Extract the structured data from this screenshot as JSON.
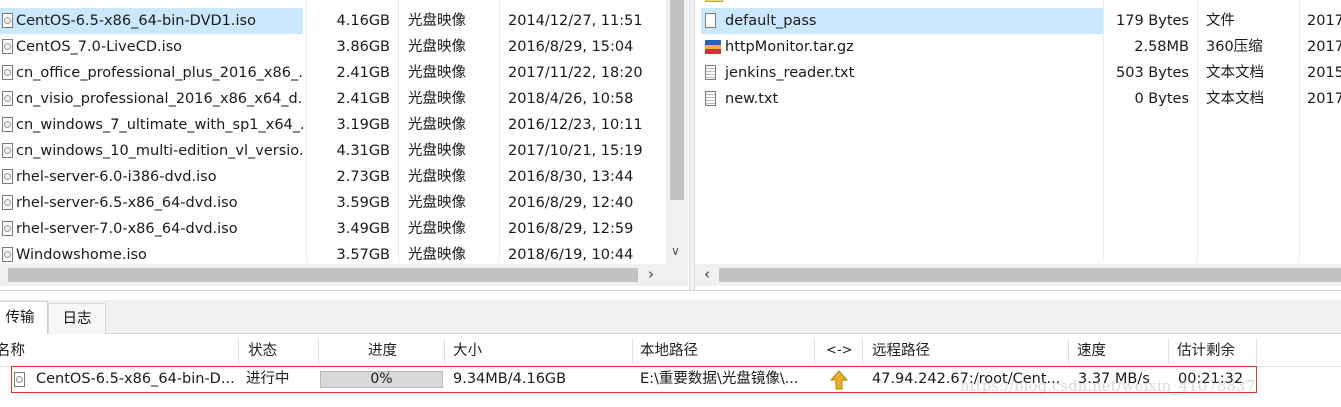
{
  "left_files": [
    {
      "name": "CentOS-6.5-x86_64-bin-DVD1.iso",
      "size": "4.16GB",
      "type": "光盘映像",
      "date": "2014/12/27, 11:51",
      "icon": "disc-file-icon",
      "selected": true
    },
    {
      "name": "CentOS_7.0-LiveCD.iso",
      "size": "3.86GB",
      "type": "光盘映像",
      "date": "2016/8/29, 15:04",
      "icon": "disc-file-icon"
    },
    {
      "name": "cn_office_professional_plus_2016_x86_...",
      "size": "2.41GB",
      "type": "光盘映像",
      "date": "2017/11/22, 18:20",
      "icon": "disc-file-icon"
    },
    {
      "name": "cn_visio_professional_2016_x86_x64_d...",
      "size": "2.41GB",
      "type": "光盘映像",
      "date": "2018/4/26, 10:58",
      "icon": "disc-file-icon"
    },
    {
      "name": "cn_windows_7_ultimate_with_sp1_x64_...",
      "size": "3.19GB",
      "type": "光盘映像",
      "date": "2016/12/23, 10:11",
      "icon": "disc-file-icon"
    },
    {
      "name": "cn_windows_10_multi-edition_vl_versio...",
      "size": "4.31GB",
      "type": "光盘映像",
      "date": "2017/10/21, 15:19",
      "icon": "disc-file-icon"
    },
    {
      "name": "rhel-server-6.0-i386-dvd.iso",
      "size": "2.73GB",
      "type": "光盘映像",
      "date": "2016/8/30, 13:44",
      "icon": "disc-file-icon"
    },
    {
      "name": "rhel-server-6.5-x86_64-dvd.iso",
      "size": "3.59GB",
      "type": "光盘映像",
      "date": "2016/8/29, 12:40",
      "icon": "disc-file-icon"
    },
    {
      "name": "rhel-server-7.0-x86_64-dvd.iso",
      "size": "3.49GB",
      "type": "光盘映像",
      "date": "2016/8/29, 12:59",
      "icon": "disc-file-icon"
    },
    {
      "name": "Windowshome.iso",
      "size": "3.57GB",
      "type": "光盘映像",
      "date": "2018/6/19, 10:44",
      "icon": "disc-file-icon"
    }
  ],
  "right_files": [
    {
      "name": "default_pass",
      "size": "179 Bytes",
      "type": "文件",
      "date": "2017",
      "icon": "blank-file-icon",
      "selected": true
    },
    {
      "name": "httpMonitor.tar.gz",
      "size": "2.58MB",
      "type": "360压缩",
      "date": "2017",
      "icon": "archive-file-icon"
    },
    {
      "name": "jenkins_reader.txt",
      "size": "503 Bytes",
      "type": "文本文档",
      "date": "2015",
      "icon": "text-file-icon"
    },
    {
      "name": "new.txt",
      "size": "0 Bytes",
      "type": "文本文档",
      "date": "2017",
      "icon": "text-file-icon"
    }
  ],
  "tabs": {
    "transfer": "传输",
    "log": "日志"
  },
  "transfer_headers": {
    "name": "名称",
    "status": "状态",
    "progress": "进度",
    "size": "大小",
    "local": "本地路径",
    "dir": "<->",
    "remote": "远程路径",
    "speed": "速度",
    "eta": "估计剩余"
  },
  "transfer": {
    "name": "CentOS-6.5-x86_64-bin-D...",
    "status": "进行中",
    "progress_label": "0%",
    "progress_fraction": 0.0,
    "size": "9.34MB/4.16GB",
    "local": "E:\\重要数据\\光盘镜像\\...",
    "remote": "47.94.242.67:/root/Cent...",
    "speed": "3.37 MB/s",
    "eta": "00:21:32"
  },
  "watermark": "https://blog.csdn.net/weixin_41078837",
  "colors": {
    "selection": "#cce8ff",
    "highlight_border": "#d9322c",
    "upload_arrow": "#e8b020"
  }
}
